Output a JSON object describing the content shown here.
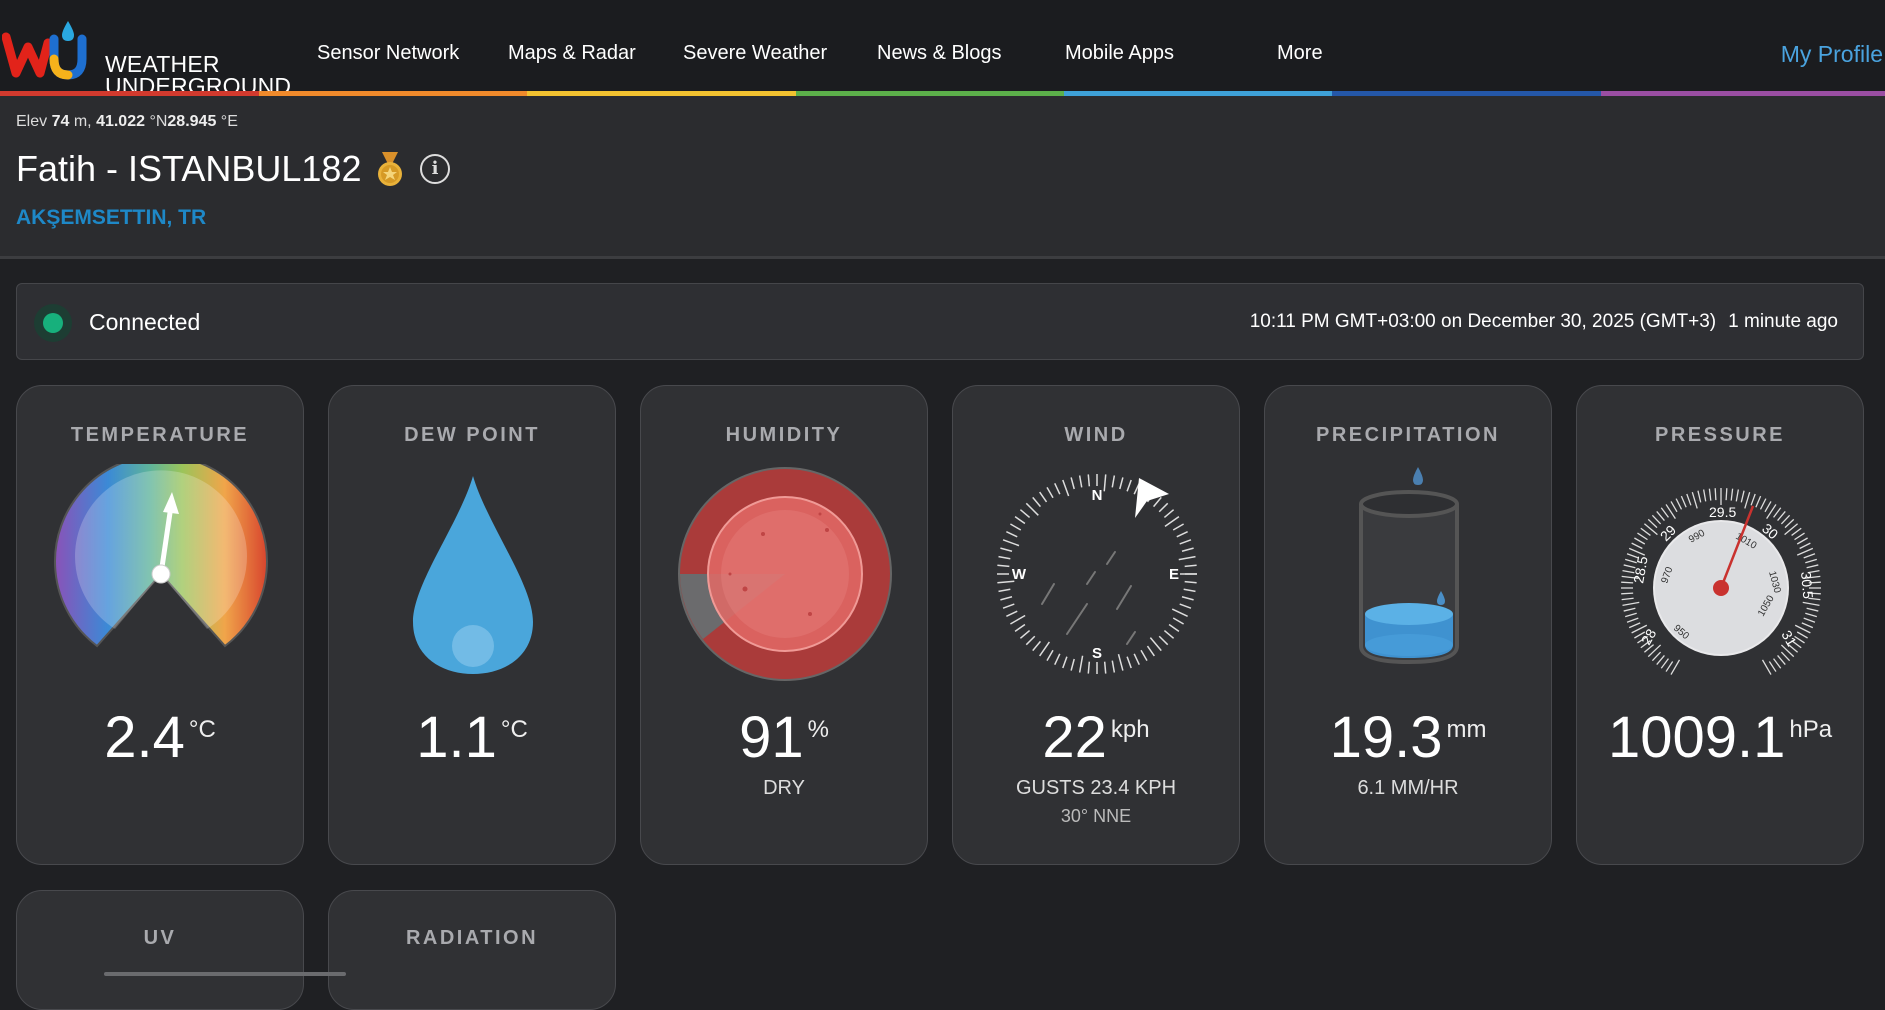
{
  "nav": {
    "logo_line1": "WEATHER",
    "logo_line2": "UNDERGROUND",
    "items": [
      "Sensor Network",
      "Maps & Radar",
      "Severe Weather",
      "News & Blogs",
      "Mobile Apps",
      "More"
    ],
    "profile": "My Profile"
  },
  "station": {
    "elev_label": "Elev",
    "elev_value": "74",
    "elev_unit": "m,",
    "lat": "41.022",
    "lat_unit": "°N",
    "lon": "28.945",
    "lon_unit": "°E",
    "title": "Fatih - ISTANBUL182",
    "location": "AKŞEMSETTIN, TR"
  },
  "status": {
    "connection": "Connected",
    "timestamp": "10:11 PM GMT+03:00 on December 30, 2025 (GMT+3)",
    "ago": "1 minute ago"
  },
  "cards": {
    "temperature": {
      "title": "TEMPERATURE",
      "value": "2.4",
      "unit": "°C"
    },
    "dewpoint": {
      "title": "DEW POINT",
      "value": "1.1",
      "unit": "°C"
    },
    "humidity": {
      "title": "HUMIDITY",
      "value": "91",
      "unit": "%",
      "sub": "DRY"
    },
    "wind": {
      "title": "WIND",
      "value": "22",
      "unit": "kph",
      "gusts": "GUSTS 23.4 KPH",
      "direction": "30° NNE",
      "compass": [
        "N",
        "E",
        "S",
        "W"
      ]
    },
    "precipitation": {
      "title": "PRECIPITATION",
      "value": "19.3",
      "unit": "mm",
      "rate": "6.1 MM/HR"
    },
    "pressure": {
      "title": "PRESSURE",
      "value": "1009.1",
      "unit": "hPa",
      "inhg_labels": [
        "28",
        "28.5",
        "29",
        "29.5",
        "30",
        "30.5",
        "31"
      ],
      "hpa_labels": [
        "950",
        "970",
        "990",
        "1010",
        "1030",
        "1050"
      ]
    },
    "uv": {
      "title": "UV"
    },
    "radiation": {
      "title": "RADIATION"
    }
  },
  "colors": {
    "accent_blue": "#4aa3df",
    "location_blue": "#1e88c7",
    "connected_green": "#17b07c",
    "card_bg": "#303134"
  }
}
